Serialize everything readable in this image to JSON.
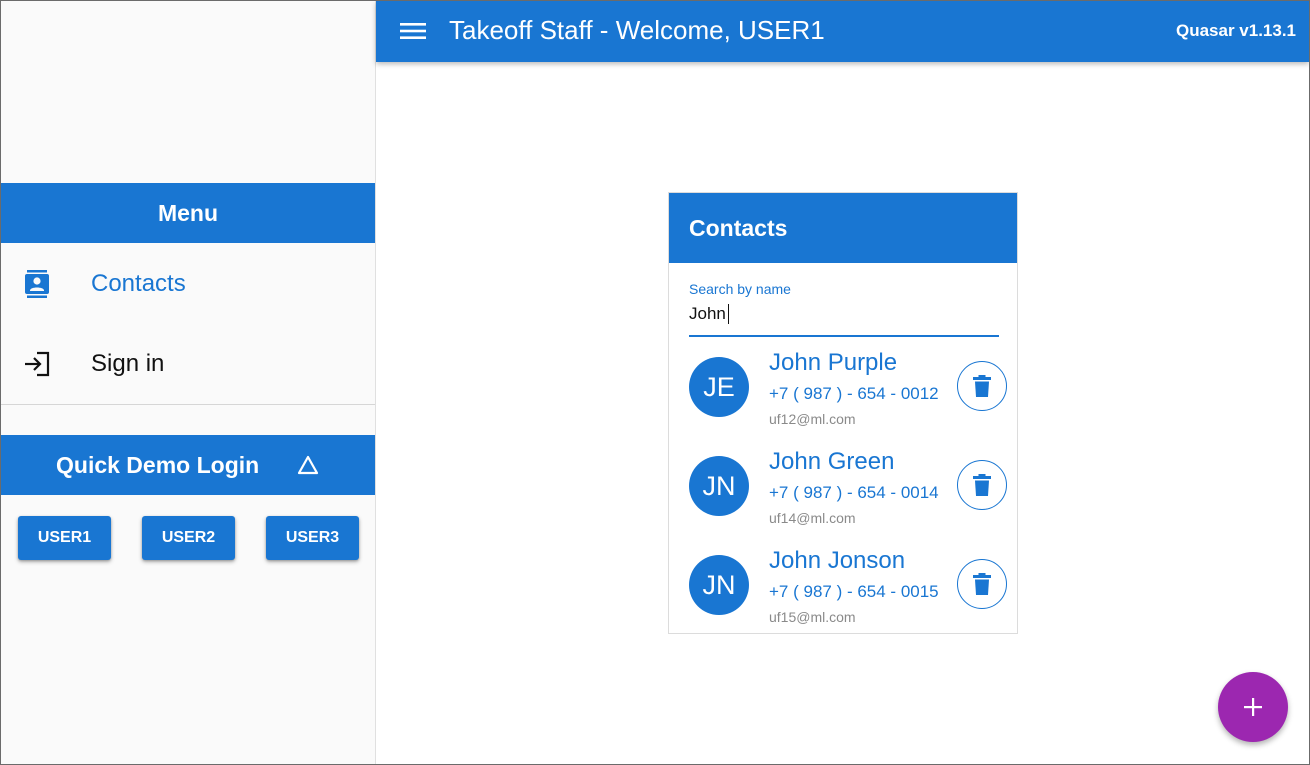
{
  "header": {
    "title": "Takeoff Staff - Welcome, USER1",
    "version": "Quasar v1.13.1",
    "menu_icon": "hamburger-menu-icon",
    "color": "#1976d2"
  },
  "drawer": {
    "menu_title": "Menu",
    "items": [
      {
        "label": "Contacts",
        "icon": "contacts-icon",
        "active": true
      },
      {
        "label": "Sign in",
        "icon": "login-icon",
        "active": false
      }
    ],
    "quick_login": {
      "title": "Quick Demo Login",
      "toggle_icon": "triangle-up-icon",
      "users": [
        "USER1",
        "USER2",
        "USER3"
      ]
    }
  },
  "contacts_card": {
    "title": "Contacts",
    "search": {
      "label": "Search by name",
      "value": "John"
    },
    "contacts": [
      {
        "initials": "JE",
        "name": "John Purple",
        "phone": "+7 ( 987 ) - 654 - 0012",
        "email": "uf12@ml.com"
      },
      {
        "initials": "JN",
        "name": "John Green",
        "phone": "+7 ( 987 ) - 654 - 0014",
        "email": "uf14@ml.com"
      },
      {
        "initials": "JN",
        "name": "John Jonson",
        "phone": "+7 ( 987 ) - 654 - 0015",
        "email": "uf15@ml.com"
      }
    ],
    "delete_icon": "trash-icon"
  },
  "fab": {
    "icon": "plus-icon",
    "color": "#9c27b0"
  }
}
